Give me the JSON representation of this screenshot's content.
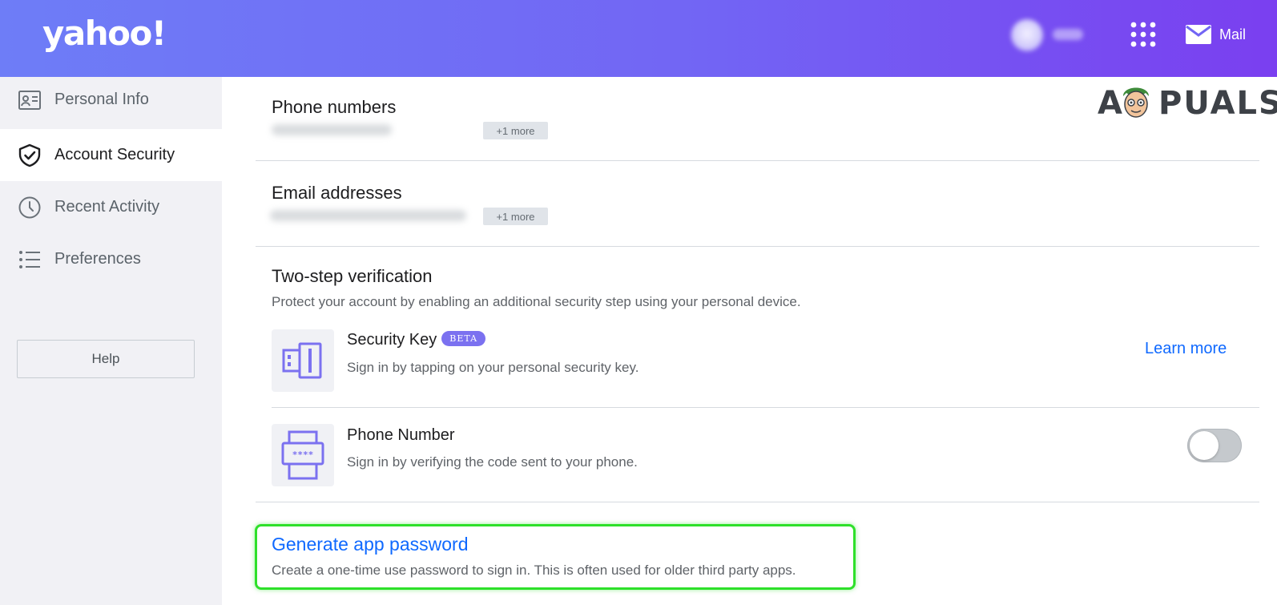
{
  "header": {
    "logo_text": "yahoo!",
    "mail_label": "Mail",
    "gradient_colors": [
      "#6e7df7",
      "#7a3ff0"
    ]
  },
  "sidebar": {
    "items": [
      {
        "label": "Personal Info",
        "icon": "id-card-icon",
        "active": false
      },
      {
        "label": "Account Security",
        "icon": "shield-check-icon",
        "active": true
      },
      {
        "label": "Recent Activity",
        "icon": "clock-icon",
        "active": false
      },
      {
        "label": "Preferences",
        "icon": "list-icon",
        "active": false
      }
    ],
    "help_label": "Help"
  },
  "main": {
    "phone_numbers": {
      "title": "Phone numbers",
      "more_label": "+1 more"
    },
    "email_addresses": {
      "title": "Email addresses",
      "more_label": "+1 more"
    },
    "two_step": {
      "title": "Two-step verification",
      "description": "Protect your account by enabling an additional security step using your personal device.",
      "security_key": {
        "title": "Security Key",
        "badge": "BETA",
        "description": "Sign in by tapping on your personal security key.",
        "link": "Learn more"
      },
      "phone_number": {
        "title": "Phone Number",
        "description": "Sign in by verifying the code sent to your phone.",
        "toggle_on": false
      }
    },
    "app_password": {
      "link": "Generate app password",
      "description": "Create a one-time use password to sign in. This is often used for older third party apps."
    }
  },
  "watermark": {
    "text_left": "A",
    "text_right": "PUALS"
  },
  "colors": {
    "link": "#0f69ff",
    "accent_purple": "#7b71f0",
    "highlight_green": "#2ee02a",
    "sidebar_bg": "#f1f1f5"
  }
}
